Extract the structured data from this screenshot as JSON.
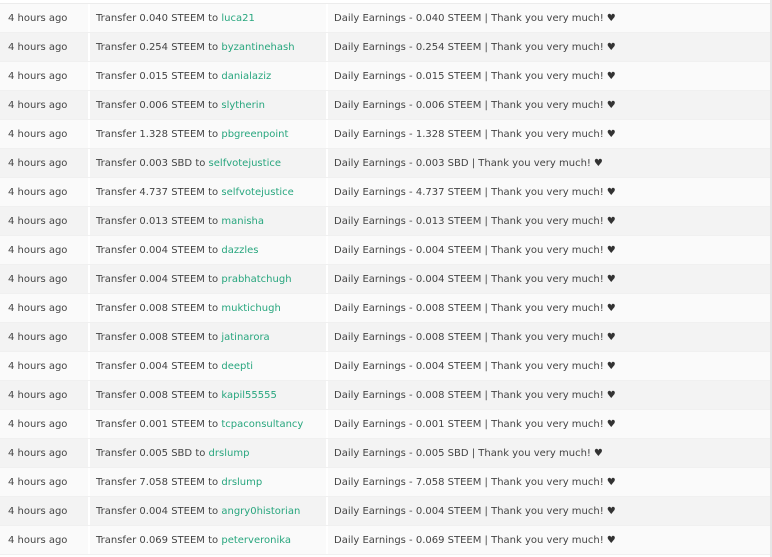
{
  "labels": {
    "transfer": "Transfer",
    "to": "to",
    "heart": "♥"
  },
  "rows": [
    {
      "time": "4 hours ago",
      "amount": "0.040 STEEM",
      "recipient": "luca21",
      "memo": "Daily Earnings - 0.040 STEEM | Thank you very much!"
    },
    {
      "time": "4 hours ago",
      "amount": "0.254 STEEM",
      "recipient": "byzantinehash",
      "memo": "Daily Earnings - 0.254 STEEM | Thank you very much!"
    },
    {
      "time": "4 hours ago",
      "amount": "0.015 STEEM",
      "recipient": "danialaziz",
      "memo": "Daily Earnings - 0.015 STEEM | Thank you very much!"
    },
    {
      "time": "4 hours ago",
      "amount": "0.006 STEEM",
      "recipient": "slytherin",
      "memo": "Daily Earnings - 0.006 STEEM | Thank you very much!"
    },
    {
      "time": "4 hours ago",
      "amount": "1.328 STEEM",
      "recipient": "pbgreenpoint",
      "memo": "Daily Earnings - 1.328 STEEM | Thank you very much!"
    },
    {
      "time": "4 hours ago",
      "amount": "0.003 SBD",
      "recipient": "selfvotejustice",
      "memo": "Daily Earnings - 0.003 SBD | Thank you very much!"
    },
    {
      "time": "4 hours ago",
      "amount": "4.737 STEEM",
      "recipient": "selfvotejustice",
      "memo": "Daily Earnings - 4.737 STEEM | Thank you very much!"
    },
    {
      "time": "4 hours ago",
      "amount": "0.013 STEEM",
      "recipient": "manisha",
      "memo": "Daily Earnings - 0.013 STEEM | Thank you very much!"
    },
    {
      "time": "4 hours ago",
      "amount": "0.004 STEEM",
      "recipient": "dazzles",
      "memo": "Daily Earnings - 0.004 STEEM | Thank you very much!"
    },
    {
      "time": "4 hours ago",
      "amount": "0.004 STEEM",
      "recipient": "prabhatchugh",
      "memo": "Daily Earnings - 0.004 STEEM | Thank you very much!"
    },
    {
      "time": "4 hours ago",
      "amount": "0.008 STEEM",
      "recipient": "muktichugh",
      "memo": "Daily Earnings - 0.008 STEEM | Thank you very much!"
    },
    {
      "time": "4 hours ago",
      "amount": "0.008 STEEM",
      "recipient": "jatinarora",
      "memo": "Daily Earnings - 0.008 STEEM | Thank you very much!"
    },
    {
      "time": "4 hours ago",
      "amount": "0.004 STEEM",
      "recipient": "deepti",
      "memo": "Daily Earnings - 0.004 STEEM | Thank you very much!"
    },
    {
      "time": "4 hours ago",
      "amount": "0.008 STEEM",
      "recipient": "kapil55555",
      "memo": "Daily Earnings - 0.008 STEEM | Thank you very much!"
    },
    {
      "time": "4 hours ago",
      "amount": "0.001 STEEM",
      "recipient": "tcpaconsultancy",
      "memo": "Daily Earnings - 0.001 STEEM | Thank you very much!"
    },
    {
      "time": "4 hours ago",
      "amount": "0.005 SBD",
      "recipient": "drslump",
      "memo": "Daily Earnings - 0.005 SBD | Thank you very much!"
    },
    {
      "time": "4 hours ago",
      "amount": "7.058 STEEM",
      "recipient": "drslump",
      "memo": "Daily Earnings - 7.058 STEEM | Thank you very much!"
    },
    {
      "time": "4 hours ago",
      "amount": "0.004 STEEM",
      "recipient": "angry0historian",
      "memo": "Daily Earnings - 0.004 STEEM | Thank you very much!"
    },
    {
      "time": "4 hours ago",
      "amount": "0.069 STEEM",
      "recipient": "peterveronika",
      "memo": "Daily Earnings - 0.069 STEEM | Thank you very much!"
    }
  ]
}
